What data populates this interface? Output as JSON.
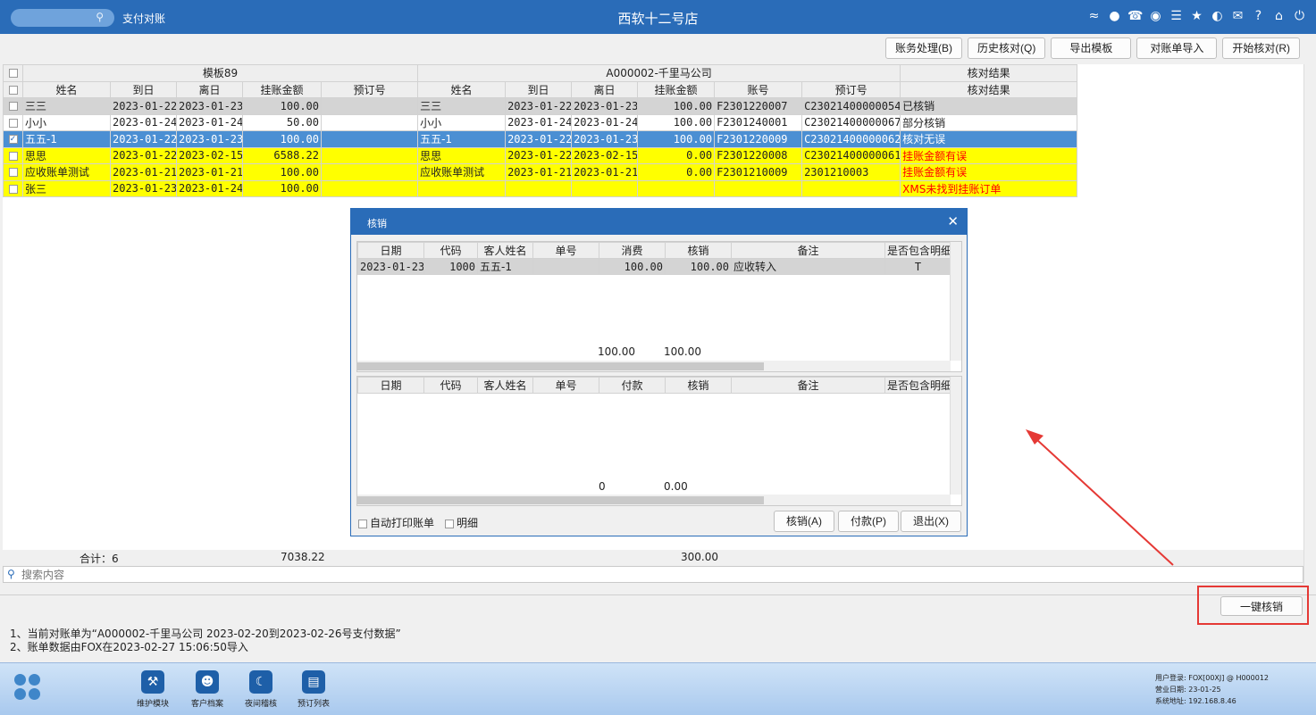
{
  "titlebar": {
    "module_label": "支付对账",
    "app_title": "西软十二号店",
    "icons": [
      "wifi-icon",
      "chat-icon",
      "phone-icon",
      "palette-icon",
      "menu-icon",
      "star-icon",
      "contrast-icon",
      "mail-icon",
      "help-icon",
      "home-icon",
      "power-icon"
    ]
  },
  "toolbar": {
    "account_process": "账务处理(B)",
    "history_check": "历史核对(Q)",
    "export_template": "导出模板",
    "import_statement": "对账单导入",
    "start_check": "开始核对(R)"
  },
  "grid": {
    "group_left": "模板89",
    "group_right": "A000002-千里马公司",
    "group_result": "核对结果",
    "columns": [
      "姓名",
      "到日",
      "离日",
      "挂账金额",
      "预订号",
      "姓名",
      "到日",
      "离日",
      "挂账金额",
      "账号",
      "预订号",
      "核对结果"
    ],
    "rows": [
      {
        "style": "gray",
        "checked": false,
        "cells": [
          "三三",
          "2023-01-22",
          "2023-01-23",
          "100.00",
          "",
          "三三",
          "2023-01-22",
          "2023-01-23",
          "100.00",
          "F2301220007",
          "C23021400000054",
          "已核销"
        ],
        "red": false
      },
      {
        "style": "white",
        "checked": false,
        "cells": [
          "小小",
          "2023-01-24",
          "2023-01-24",
          "50.00",
          "",
          "小小",
          "2023-01-24",
          "2023-01-24",
          "100.00",
          "F2301240001",
          "C23021400000067",
          "部分核销"
        ],
        "red": false
      },
      {
        "style": "sel",
        "checked": true,
        "cells": [
          "五五-1",
          "2023-01-22",
          "2023-01-23",
          "100.00",
          "",
          "五五-1",
          "2023-01-22",
          "2023-01-23",
          "100.00",
          "F2301220009",
          "C23021400000062",
          "核对无误"
        ],
        "red": false
      },
      {
        "style": "yellow",
        "checked": false,
        "cells": [
          "思思",
          "2023-01-22",
          "2023-02-15",
          "6588.22",
          "",
          "思思",
          "2023-01-22",
          "2023-02-15",
          "0.00",
          "F2301220008",
          "C23021400000061",
          "挂账金额有误"
        ],
        "red": true
      },
      {
        "style": "yellow",
        "checked": false,
        "cells": [
          "应收账单测试",
          "2023-01-21",
          "2023-01-21",
          "100.00",
          "",
          "应收账单测试",
          "2023-01-21",
          "2023-01-21",
          "0.00",
          "F2301210009",
          "2301210003",
          "挂账金额有误"
        ],
        "red": true
      },
      {
        "style": "yellow",
        "checked": false,
        "cells": [
          "张三",
          "2023-01-23",
          "2023-01-24",
          "100.00",
          "",
          "",
          "",
          "",
          "",
          "",
          "",
          "XMS未找到挂账订单"
        ],
        "red": true
      }
    ]
  },
  "totals": {
    "label": "合计：6",
    "left_amount": "7038.22",
    "right_amount": "300.00"
  },
  "search": {
    "placeholder": "搜索内容"
  },
  "onekey_button": "一键核销",
  "notes": {
    "line1": "1、当前对账单为“A000002-千里马公司 2023-02-20到2023-02-26号支付数据”",
    "line2": "2、账单数据由FOX在2023-02-27 15:06:50导入"
  },
  "dock": {
    "items": [
      {
        "label": "维护模块",
        "icon": "wrench-icon"
      },
      {
        "label": "客户档案",
        "icon": "contact-card-icon"
      },
      {
        "label": "夜间稽核",
        "icon": "moon-icon"
      },
      {
        "label": "预订列表",
        "icon": "list-icon"
      }
    ]
  },
  "sysinfo": {
    "user": "用户登录:  FOX[00XJ] @ H000012",
    "business_date": "营业日期:  23-01-25",
    "system_address": "系统地址:  192.168.8.46"
  },
  "dialog": {
    "title": "核销",
    "top_columns": [
      "日期",
      "代码",
      "客人姓名",
      "单号",
      "消费",
      "核销",
      "备注",
      "是否包含明细"
    ],
    "top_rows": [
      [
        "2023-01-23",
        "1000",
        "五五-1",
        "",
        "100.00",
        "100.00",
        "应收转入",
        "T"
      ]
    ],
    "top_sum": {
      "consume": "100.00",
      "writeoff": "100.00"
    },
    "bottom_columns": [
      "日期",
      "代码",
      "客人姓名",
      "单号",
      "付款",
      "核销",
      "备注",
      "是否包含明细"
    ],
    "bottom_sum": {
      "payment": "0",
      "writeoff": "0.00"
    },
    "auto_print_label": "自动打印账单",
    "detail_label": "明细",
    "writeoff_button": "核销(A)",
    "pay_button": "付款(P)",
    "exit_button": "退出(X)"
  },
  "colors": {
    "titlebar": "#2a6cb8",
    "selected_row": "#4b8fd3",
    "error_row": "#ffff00",
    "error_text": "#ff0000",
    "annotation": "#e53935"
  }
}
